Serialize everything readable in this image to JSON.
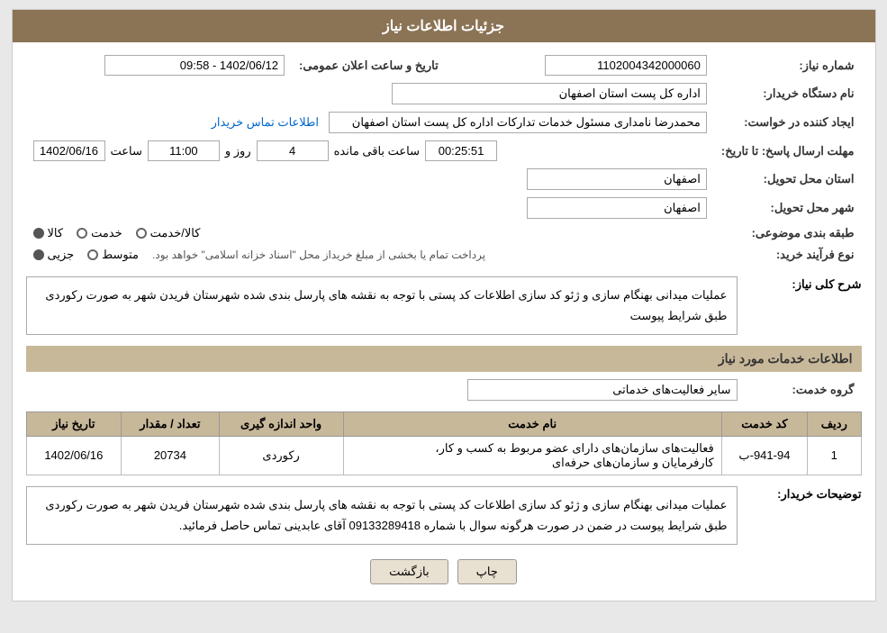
{
  "header": {
    "title": "جزئیات اطلاعات نیاز"
  },
  "fields": {
    "shomareNiaz_label": "شماره نیاز:",
    "shomareNiaz_value": "1102004342000060",
    "namDastgah_label": "نام دستگاه خریدار:",
    "namDastgah_value": "اداره کل پست استان اصفهان",
    "tarikh_label": "تاریخ و ساعت اعلان عمومی:",
    "tarikh_value": "1402/06/12 - 09:58",
    "ijadKonande_label": "ایجاد کننده در خواست:",
    "ijadKonande_value": "محمدرضا نامداری مسئول خدمات تدارکات اداره کل پست استان اصفهان",
    "ijadKonande_link": "اطلاعات تماس خریدار",
    "mohlatErsal_label": "مهلت ارسال پاسخ: تا تاریخ:",
    "mohlatErsal_date": "1402/06/16",
    "mohlatErsal_saat_label": "ساعت",
    "mohlatErsal_saat": "11:00",
    "mohlatErsal_roz_label": "روز و",
    "mohlatErsal_roz": "4",
    "baghiMande_label": "ساعت باقی مانده",
    "baghiMande_value": "00:25:51",
    "ostanTahvil_label": "استان محل تحویل:",
    "ostanTahvil_value": "اصفهان",
    "shahrTahvil_label": "شهر محل تحویل:",
    "shahrTahvil_value": "اصفهان",
    "tabaqeBandi_label": "طبقه بندی موضوعی:",
    "tabaqeBandi_kala": "کالا",
    "tabaqeBandi_khedmat": "خدمت",
    "tabaqeBandi_kalaKhedmat": "کالا/خدمت",
    "tabaqeBandi_selected": "کالا",
    "noeFarayand_label": "نوع فرآیند خرید:",
    "noeFarayand_jezee": "جزیی",
    "noeFarayand_motevasset": "متوسط",
    "noeFarayand_text": "پرداخت تمام یا بخشی از مبلغ خریداز محل \"اسناد خزانه اسلامی\" خواهد بود.",
    "shahreKoli_label": "شرح کلی نیاز:",
    "shahreKoli_value": "عملیات میدانی بهنگام سازی و ژئو کد سازی اطلاعات کد پستی با توجه به نقشه های پارسل بندی شده شهرستان فریدن شهر به صورت رکوردی  طبق شرایط پیوست",
    "etelaat_section": "اطلاعات خدمات مورد نیاز",
    "groheKhedmat_label": "گروه خدمت:",
    "groheKhedmat_value": "سایر فعالیت‌های خدماتی",
    "table": {
      "headers": [
        "ردیف",
        "کد خدمت",
        "نام خدمت",
        "واحد اندازه گیری",
        "تعداد / مقدار",
        "تاریخ نیاز"
      ],
      "rows": [
        {
          "radif": "1",
          "kod": "941-94-ب",
          "nam": "فعالیت‌های سازمان‌های دارای عضو مربوط به کسب و کار، کارفرمایان و سازمان‌های حرفه‌ای",
          "vahed": "رکوردی",
          "tedad": "20734",
          "tarikh": "1402/06/16"
        }
      ]
    },
    "tawzihat_label": "توضیحات خریدار:",
    "tawzihat_value": "عملیات میدانی بهنگام سازی و ژئو کد سازی اطلاعات کد پستی با توجه به نقشه های پارسل بندی شده شهرستان فریدن شهر به صورت رکوردی  طبق شرایط پیوست در ضمن در صورت هرگونه سوال با شماره 09133289418 آقای عابدینی تماس حاصل فرمائید.",
    "buttons": {
      "chap": "چاپ",
      "bazgasht": "بازگشت"
    }
  }
}
